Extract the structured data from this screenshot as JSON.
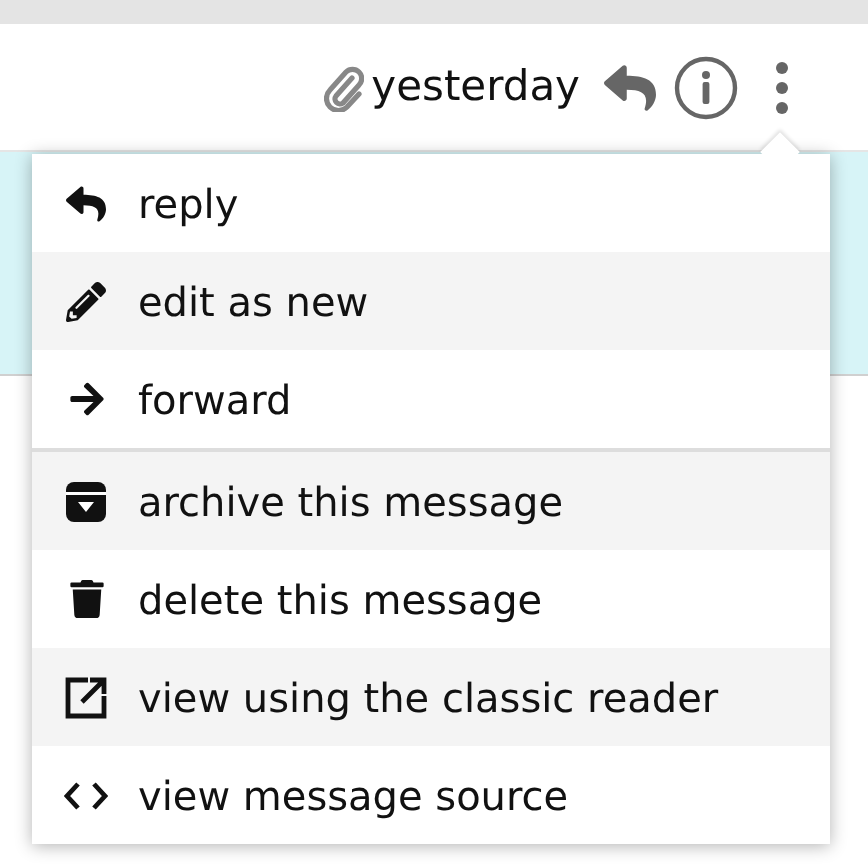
{
  "header": {
    "date": "yesterday"
  },
  "menu": {
    "groups": [
      [
        {
          "label": "reply"
        },
        {
          "label": "edit as new"
        },
        {
          "label": "forward"
        }
      ],
      [
        {
          "label": "archive this message"
        },
        {
          "label": "delete this message"
        },
        {
          "label": "view using the classic reader"
        },
        {
          "label": "view message source"
        }
      ]
    ]
  }
}
